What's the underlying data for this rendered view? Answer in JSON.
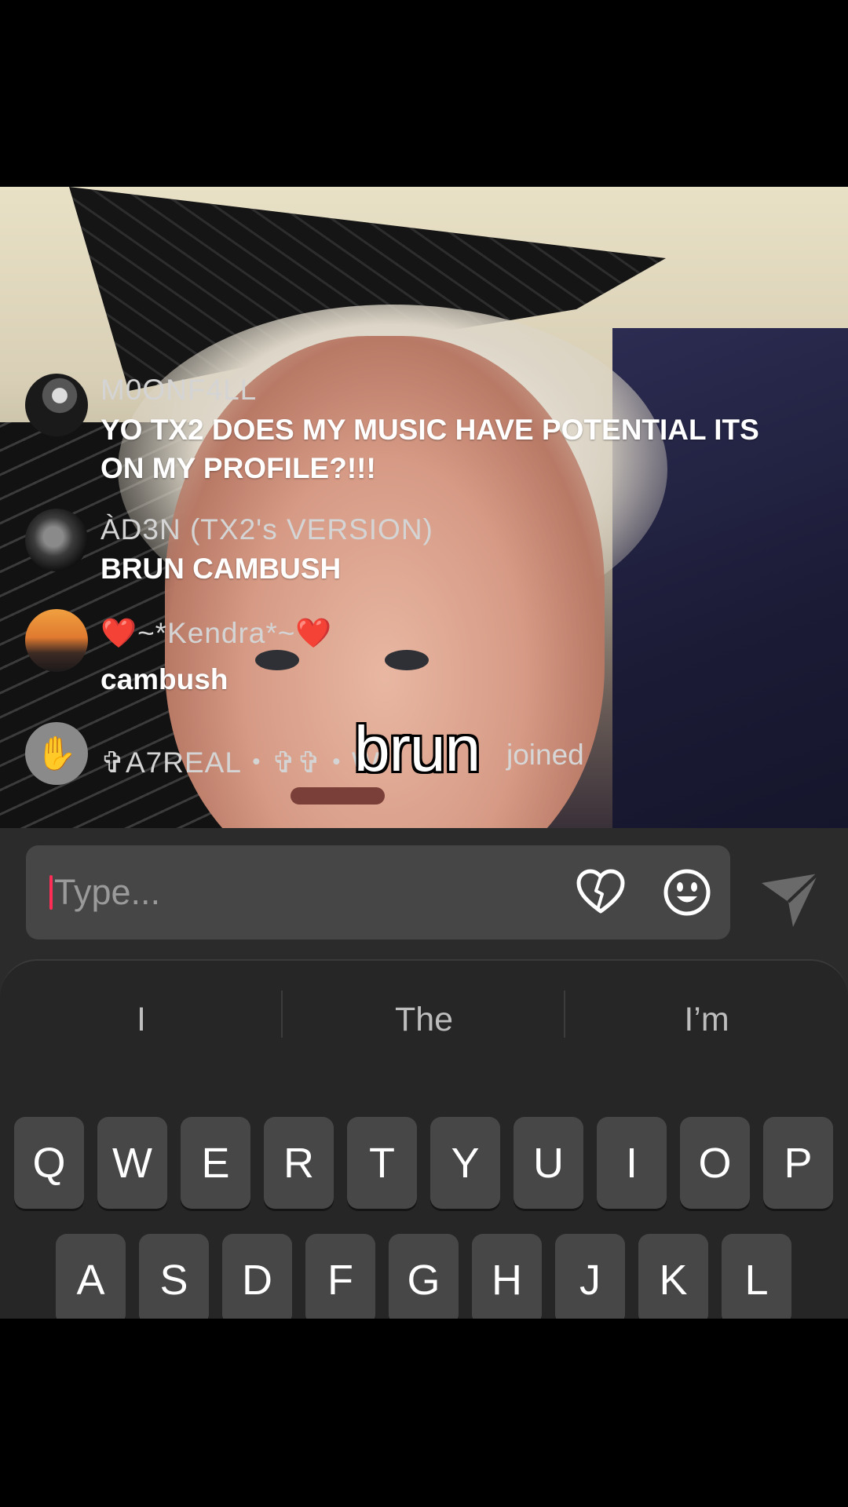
{
  "comments": [
    {
      "username": "M0ONF4LL",
      "message": "YO TX2 DOES MY MUSIC HAVE POTENTIAL ITS ON MY PROFILE?!!!"
    },
    {
      "username": "ÀD3N (TX2's VERSION)",
      "message": "BRUN CAMBUSH"
    },
    {
      "username": "❤️~*Kendra*~❤️",
      "message": "cambush"
    }
  ],
  "join_event": {
    "username": "✞A7REAL・✞✞・W",
    "action": "joined",
    "icon": "wave-hand-icon"
  },
  "caption": "brun",
  "input": {
    "placeholder": "Type..."
  },
  "suggestions": [
    "I",
    "The",
    "I’m"
  ],
  "keyboard": {
    "row1": [
      "Q",
      "W",
      "E",
      "R",
      "T",
      "Y",
      "U",
      "I",
      "O",
      "P"
    ],
    "row2": [
      "A",
      "S",
      "D",
      "F",
      "G",
      "H",
      "J",
      "K",
      "L"
    ]
  },
  "colors": {
    "accent": "#ff2d55",
    "panel": "#2b2b2b",
    "key": "#474747"
  }
}
